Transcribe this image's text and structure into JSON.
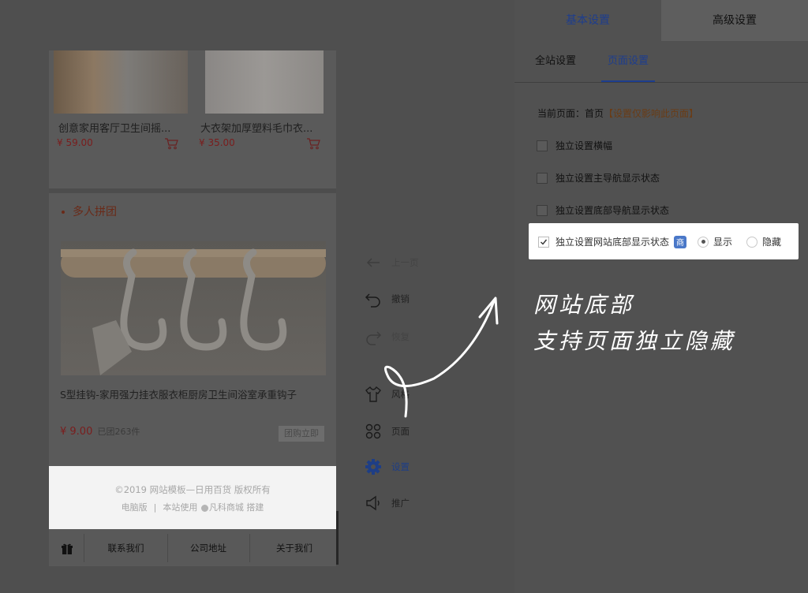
{
  "preview": {
    "products": [
      {
        "name": "创意家用客厅卫生间摇...",
        "price": "¥ 59.00"
      },
      {
        "name": "大衣架加厚塑料毛巾衣...",
        "price": "¥ 35.00"
      }
    ],
    "group_title": "多人拼团",
    "group_product": {
      "name": "S型挂钩-家用强力挂衣服衣柜厨房卫生间浴室承重钩子",
      "price": "¥ 9.00",
      "sold": "已团263件",
      "buy_label": "团购立即"
    },
    "footer": {
      "copyright": "©2019 网站模板—日用百货 版权所有",
      "link_pc": "电脑版",
      "link_sep": "|",
      "powered_prefix": "本站使用",
      "powered_brand": "凡科商城",
      "powered_suffix": "搭建"
    },
    "bottom_nav": [
      "联系我们",
      "公司地址",
      "关于我们"
    ]
  },
  "toolbar": [
    {
      "label": "上一页",
      "icon": "arrow-left-icon",
      "state": "dim"
    },
    {
      "label": "撤销",
      "icon": "undo-icon",
      "state": "normal"
    },
    {
      "label": "恢复",
      "icon": "redo-icon",
      "state": "dim"
    },
    {
      "label": "风格",
      "icon": "shirt-icon",
      "state": "normal"
    },
    {
      "label": "页面",
      "icon": "grid-icon",
      "state": "normal"
    },
    {
      "label": "设置",
      "icon": "gear-icon",
      "state": "active"
    },
    {
      "label": "推广",
      "icon": "megaphone-icon",
      "state": "normal"
    }
  ],
  "panel": {
    "tabs": [
      "基本设置",
      "高级设置"
    ],
    "subtabs": [
      "全站设置",
      "页面设置"
    ],
    "current_page_label": "当前页面：首页",
    "current_page_link": "【设置仅影响此页面】",
    "options": [
      "独立设置横幅",
      "独立设置主导航显示状态",
      "独立设置底部导航显示状态"
    ],
    "highlight_option": {
      "label": "独立设置网站底部显示状态",
      "badge": "商",
      "radio_show": "显示",
      "radio_hide": "隐藏",
      "checked": true,
      "selected": "显示"
    }
  },
  "annotation": {
    "line1": "网站底部",
    "line2": "支持页面独立隐藏"
  },
  "colors": {
    "accent_blue": "#1d3d8e",
    "price_red": "#7a1d1d",
    "highlight_bg": "#ffffff",
    "overlay_bg": "#4f4f4f"
  }
}
